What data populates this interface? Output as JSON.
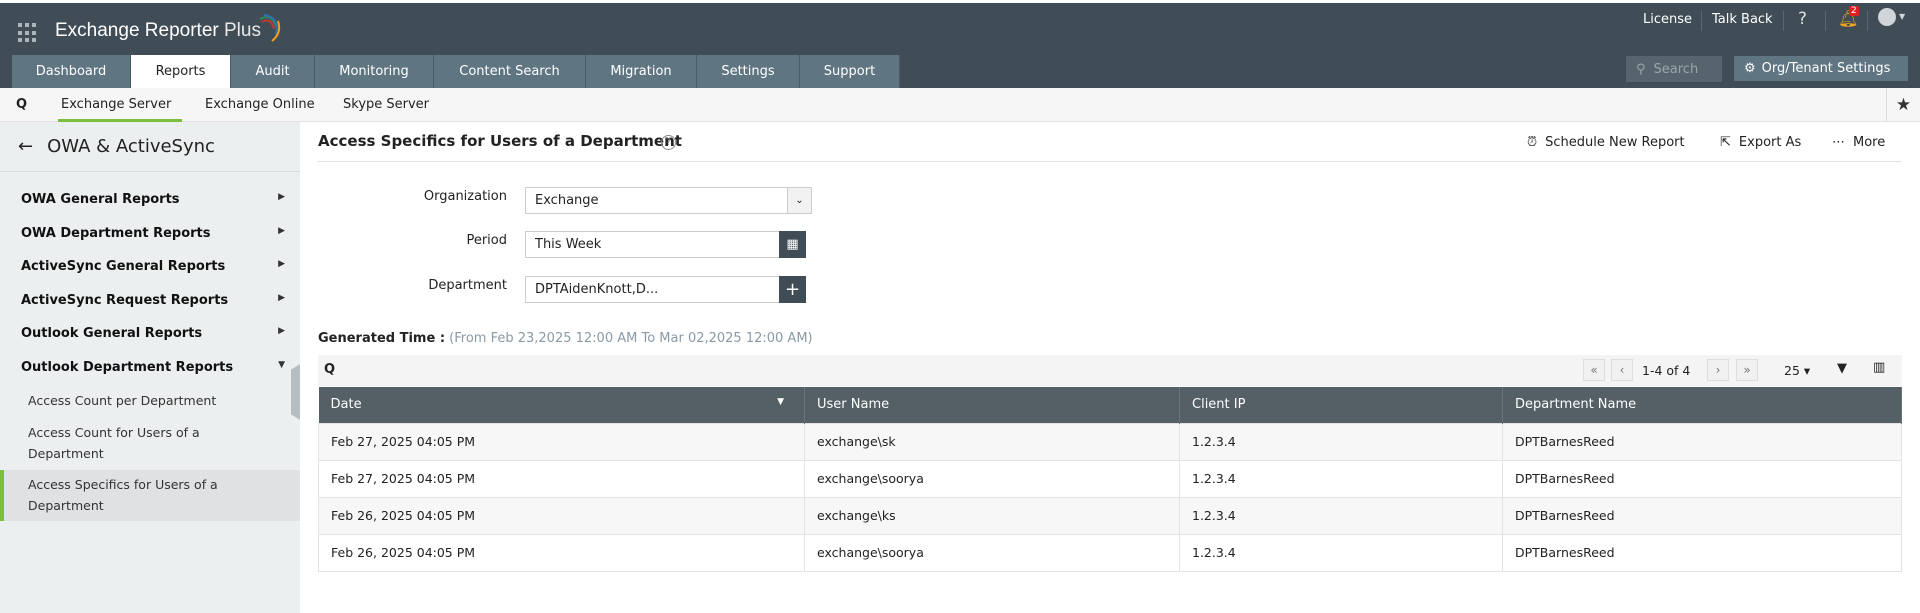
{
  "app": {
    "title": "Exchange Reporter Plus",
    "title_main": "Exchange Reporter",
    "title_plus": "Plus"
  },
  "header": {
    "license": "License",
    "talk_back": "Talk Back",
    "help": "?",
    "notification_count": "2",
    "search_placeholder": "Search",
    "org_settings": "Org/Tenant Settings"
  },
  "tabs": [
    {
      "label": "Dashboard"
    },
    {
      "label": "Reports"
    },
    {
      "label": "Audit"
    },
    {
      "label": "Monitoring"
    },
    {
      "label": "Content Search"
    },
    {
      "label": "Migration"
    },
    {
      "label": "Settings"
    },
    {
      "label": "Support"
    }
  ],
  "subnav": [
    {
      "label": "Exchange Server"
    },
    {
      "label": "Exchange Online"
    },
    {
      "label": "Skype Server"
    }
  ],
  "sidebar": {
    "title": "OWA & ActiveSync",
    "items": [
      {
        "label": "OWA General Reports"
      },
      {
        "label": "OWA Department Reports"
      },
      {
        "label": "ActiveSync General Reports"
      },
      {
        "label": "ActiveSync Request Reports"
      },
      {
        "label": "Outlook General Reports"
      },
      {
        "label": "Outlook Department Reports"
      }
    ],
    "subitems": [
      {
        "label": "Access Count per Department"
      },
      {
        "label": "Access Count for Users of a Department"
      },
      {
        "label": "Access Specifics for Users of a Department"
      }
    ]
  },
  "report": {
    "title": "Access Specifics for Users of a Department",
    "schedule": "Schedule New Report",
    "export": "Export As",
    "more": "More"
  },
  "form": {
    "org_label": "Organization",
    "org_value": "Exchange",
    "period_label": "Period",
    "period_value": "This Week",
    "dept_label": "Department",
    "dept_value": "DPTAidenKnott,D..."
  },
  "generated": {
    "label": "Generated Time :",
    "value": "(From Feb 23,2025 12:00 AM To Mar 02,2025 12:00 AM)"
  },
  "pagination": {
    "range": "1-4 of 4",
    "page_size": "25"
  },
  "table": {
    "columns": [
      "Date",
      "User Name",
      "Client IP",
      "Department Name"
    ],
    "rows": [
      [
        "Feb 27, 2025 04:05 PM",
        "exchange\\sk",
        "1.2.3.4",
        "DPTBarnesReed"
      ],
      [
        "Feb 27, 2025 04:05 PM",
        "exchange\\soorya",
        "1.2.3.4",
        "DPTBarnesReed"
      ],
      [
        "Feb 26, 2025 04:05 PM",
        "exchange\\ks",
        "1.2.3.4",
        "DPTBarnesReed"
      ],
      [
        "Feb 26, 2025 04:05 PM",
        "exchange\\soorya",
        "1.2.3.4",
        "DPTBarnesReed"
      ]
    ]
  },
  "colors": {
    "header": "#414d56",
    "tab": "#5f7582",
    "accent": "#7cbf3f",
    "table_header": "#555f66"
  }
}
